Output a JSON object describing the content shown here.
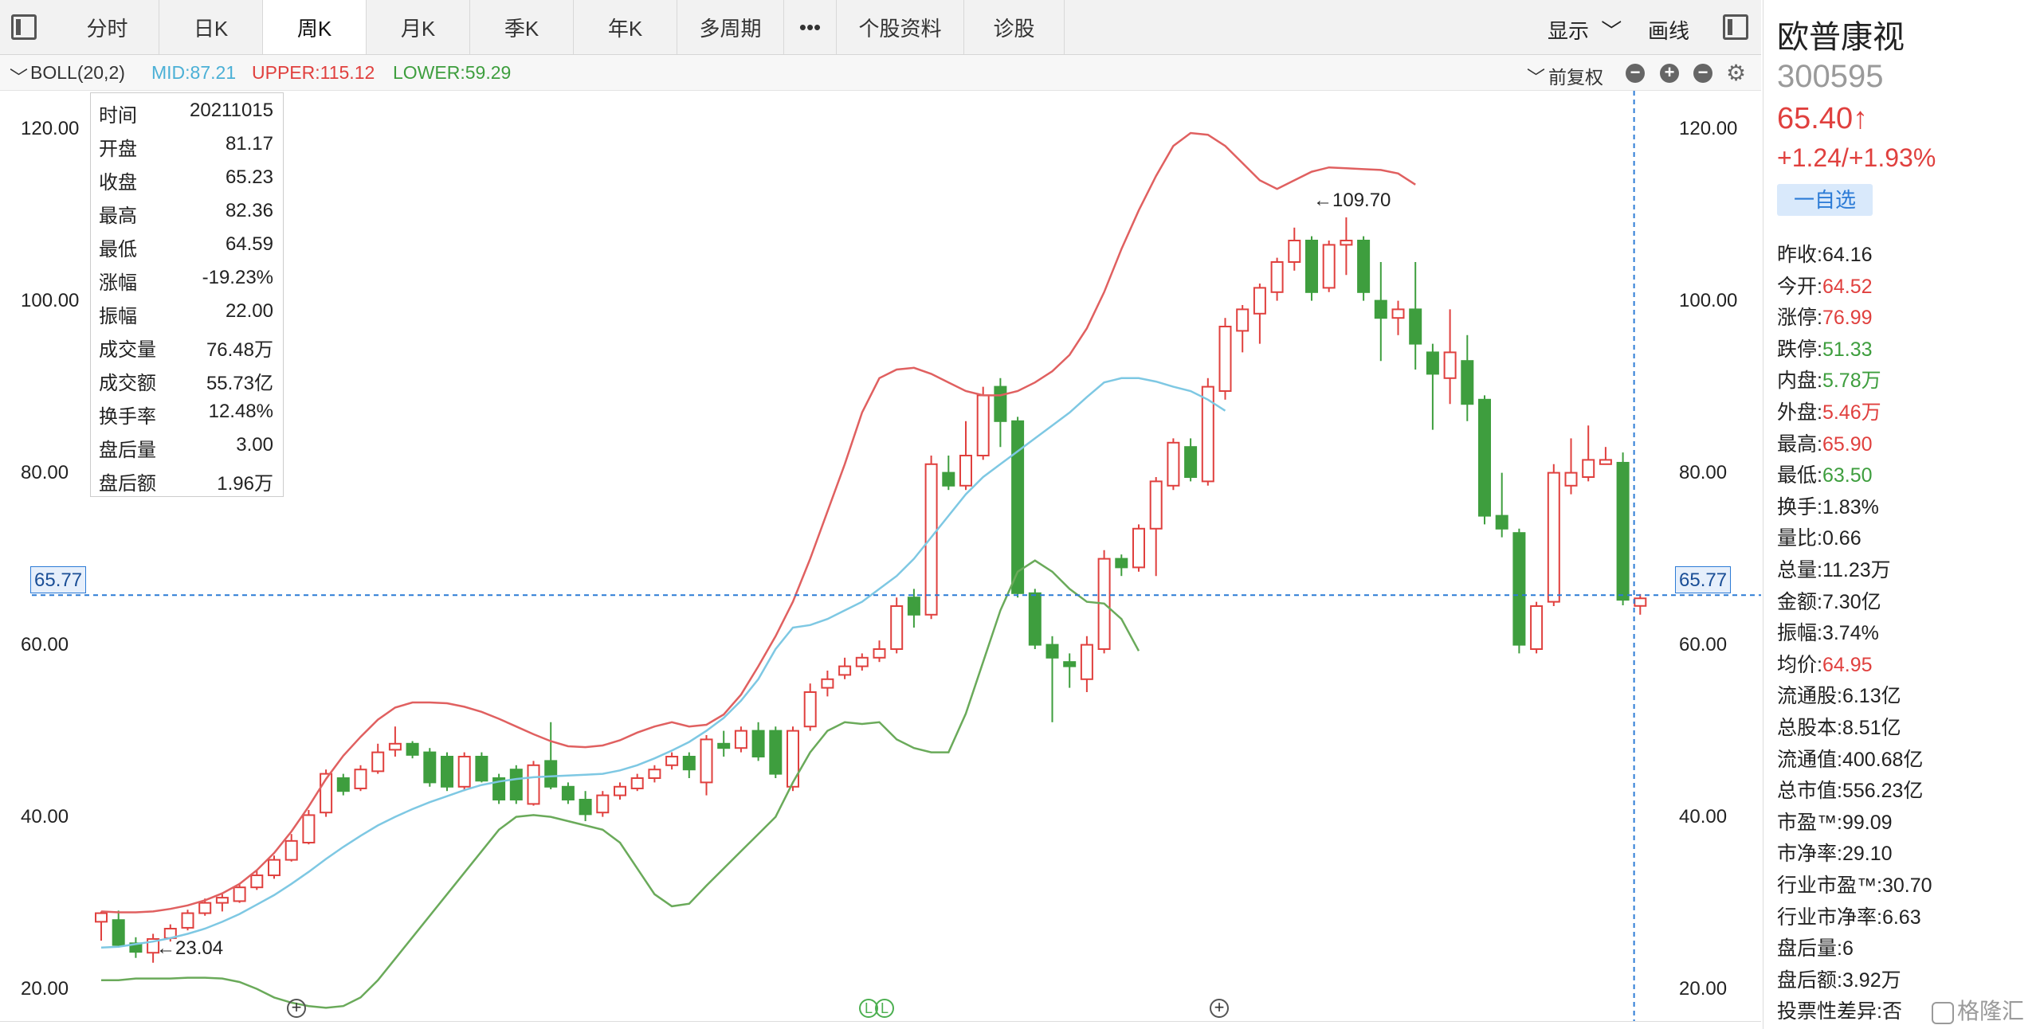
{
  "tabs": [
    {
      "label": "分时",
      "active": false
    },
    {
      "label": "日K",
      "active": false
    },
    {
      "label": "周K",
      "active": true
    },
    {
      "label": "月K",
      "active": false
    },
    {
      "label": "季K",
      "active": false
    },
    {
      "label": "年K",
      "active": false
    },
    {
      "label": "多周期",
      "active": false
    },
    {
      "label": "•••",
      "active": false
    },
    {
      "label": "个股资料",
      "active": false
    },
    {
      "label": "诊股",
      "active": false
    }
  ],
  "toolbar": {
    "display_label": "显示",
    "draw_label": "画线"
  },
  "indicator": {
    "name": "BOLL(20,2)",
    "mid": "MID:87.21",
    "upper": "UPPER:115.12",
    "lower": "LOWER:59.29",
    "adjust_label": "前复权"
  },
  "colors": {
    "up": "#e0403e",
    "down": "#3e9e3e",
    "mid": "#7ec8e3",
    "upper": "#e06060",
    "lower": "#6aaa5a",
    "crosshair": "#2c7bd6"
  },
  "info_box": [
    {
      "k": "时间",
      "v": "20211015",
      "c": "dark"
    },
    {
      "k": "开盘",
      "v": "81.17",
      "c": "red"
    },
    {
      "k": "收盘",
      "v": "65.23",
      "c": "green"
    },
    {
      "k": "最高",
      "v": "82.36",
      "c": "red"
    },
    {
      "k": "最低",
      "v": "64.59",
      "c": "green"
    },
    {
      "k": "涨幅",
      "v": "-19.23%",
      "c": "green"
    },
    {
      "k": "振幅",
      "v": "22.00",
      "c": "dark"
    },
    {
      "k": "成交量",
      "v": "76.48万",
      "c": "dark"
    },
    {
      "k": "成交额",
      "v": "55.73亿",
      "c": "dark"
    },
    {
      "k": "换手率",
      "v": "12.48%",
      "c": "dark"
    },
    {
      "k": "盘后量",
      "v": "3.00",
      "c": "dark"
    },
    {
      "k": "盘后额",
      "v": "1.96万",
      "c": "dark"
    }
  ],
  "crosshair": {
    "price_label": "65.77"
  },
  "annotations": {
    "high": "←109.70",
    "low": "←23.04"
  },
  "chart_data": {
    "type": "candlestick",
    "ylim": [
      17,
      122
    ],
    "yticks": [
      "120.00",
      "100.00",
      "80.00",
      "60.00",
      "40.00",
      "20.00"
    ],
    "crosshair_value": 65.77,
    "candles": [
      [
        27.8,
        28.8,
        25.6,
        29.0
      ],
      [
        28.0,
        25.1,
        24.8,
        29.1
      ],
      [
        25.3,
        24.3,
        23.6,
        26.0
      ],
      [
        24.2,
        25.8,
        23.04,
        26.4
      ],
      [
        25.9,
        27.0,
        25.5,
        27.5
      ],
      [
        27.1,
        28.8,
        26.8,
        29.2
      ],
      [
        28.8,
        30.0,
        28.5,
        30.5
      ],
      [
        30.0,
        30.6,
        29.0,
        31.2
      ],
      [
        30.2,
        31.8,
        30.0,
        32.3
      ],
      [
        31.8,
        33.2,
        31.5,
        33.8
      ],
      [
        33.2,
        35.0,
        32.8,
        35.5
      ],
      [
        35.0,
        37.2,
        34.8,
        38.0
      ],
      [
        37.0,
        40.2,
        36.8,
        40.8
      ],
      [
        40.5,
        45.0,
        40.0,
        45.5
      ],
      [
        44.5,
        43.0,
        42.5,
        45.0
      ],
      [
        43.3,
        45.5,
        43.0,
        46.0
      ],
      [
        45.3,
        47.5,
        45.0,
        48.5
      ],
      [
        47.8,
        48.5,
        47.0,
        50.5
      ],
      [
        48.5,
        47.2,
        46.8,
        48.8
      ],
      [
        47.5,
        44.0,
        43.5,
        48.0
      ],
      [
        47.0,
        43.5,
        43.0,
        47.5
      ],
      [
        43.5,
        47.0,
        43.0,
        47.5
      ],
      [
        47.0,
        44.2,
        44.0,
        47.5
      ],
      [
        44.5,
        42.0,
        41.5,
        45.0
      ],
      [
        45.5,
        42.0,
        41.5,
        46.0
      ],
      [
        41.5,
        46.0,
        41.3,
        46.5
      ],
      [
        46.5,
        43.5,
        43.2,
        51.0
      ],
      [
        43.5,
        42.0,
        41.5,
        44.0
      ],
      [
        42.0,
        40.3,
        39.5,
        43.0
      ],
      [
        40.5,
        42.5,
        40.0,
        43.0
      ],
      [
        42.5,
        43.5,
        42.0,
        44.0
      ],
      [
        43.3,
        44.5,
        43.0,
        45.0
      ],
      [
        44.5,
        45.5,
        44.0,
        46.0
      ],
      [
        46.0,
        47.0,
        45.5,
        47.5
      ],
      [
        47.0,
        45.5,
        44.5,
        47.5
      ],
      [
        44.0,
        49.0,
        42.5,
        49.5
      ],
      [
        48.5,
        48.0,
        47.0,
        50.0
      ],
      [
        48.0,
        50.0,
        47.5,
        50.5
      ],
      [
        50.0,
        47.0,
        46.5,
        51.0
      ],
      [
        50.0,
        45.0,
        44.5,
        50.5
      ],
      [
        43.5,
        50.0,
        43.0,
        50.5
      ],
      [
        50.5,
        54.5,
        50.0,
        55.5
      ],
      [
        55.0,
        56.0,
        54.0,
        57.0
      ],
      [
        56.5,
        57.5,
        56.0,
        58.5
      ],
      [
        57.5,
        58.5,
        57.0,
        59.0
      ],
      [
        58.5,
        59.5,
        58.0,
        60.5
      ],
      [
        59.5,
        64.5,
        59.0,
        65.5
      ],
      [
        65.5,
        63.5,
        62.0,
        66.5
      ],
      [
        63.5,
        81.0,
        63.0,
        82.0
      ],
      [
        80.0,
        78.5,
        78.0,
        82.0
      ],
      [
        78.5,
        82.0,
        78.0,
        86.0
      ],
      [
        82.0,
        89.0,
        81.5,
        90.0
      ],
      [
        90.0,
        86.0,
        83.0,
        91.0
      ],
      [
        86.0,
        66.0,
        65.5,
        86.5
      ],
      [
        66.0,
        60.0,
        59.5,
        66.5
      ],
      [
        60.0,
        58.5,
        51.0,
        61.0
      ],
      [
        58.0,
        57.5,
        55.0,
        59.0
      ],
      [
        56.0,
        60.0,
        54.5,
        61.0
      ],
      [
        59.5,
        70.0,
        59.0,
        71.0
      ],
      [
        70.0,
        69.0,
        68.0,
        70.5
      ],
      [
        69.0,
        73.5,
        68.5,
        74.0
      ],
      [
        73.5,
        79.0,
        68.0,
        79.5
      ],
      [
        78.5,
        83.5,
        78.0,
        84.0
      ],
      [
        83.0,
        79.5,
        79.0,
        84.0
      ],
      [
        79.0,
        90.0,
        78.5,
        91.0
      ],
      [
        89.5,
        97.0,
        88.5,
        98.0
      ],
      [
        96.5,
        99.0,
        94.0,
        99.5
      ],
      [
        98.5,
        101.5,
        95.0,
        102.0
      ],
      [
        101.0,
        104.5,
        100.0,
        105.0
      ],
      [
        104.5,
        107.0,
        103.5,
        108.5
      ],
      [
        107.0,
        101.0,
        100.0,
        107.5
      ],
      [
        101.5,
        106.5,
        101.0,
        107.0
      ],
      [
        106.5,
        107.0,
        103.0,
        109.7
      ],
      [
        107.0,
        101.0,
        100.0,
        107.5
      ],
      [
        100.0,
        98.0,
        93.0,
        104.5
      ],
      [
        98.0,
        99.0,
        96.0,
        100.0
      ],
      [
        99.0,
        95.0,
        92.0,
        104.5
      ],
      [
        94.0,
        91.5,
        85.0,
        95.0
      ],
      [
        91.0,
        94.0,
        88.0,
        99.0
      ],
      [
        93.0,
        88.0,
        86.0,
        96.0
      ],
      [
        88.5,
        75.0,
        74.0,
        89.0
      ],
      [
        75.0,
        73.5,
        72.5,
        80.0
      ],
      [
        73.0,
        60.0,
        59.0,
        73.5
      ],
      [
        59.5,
        64.5,
        59.0,
        65.0
      ],
      [
        65.0,
        80.0,
        64.5,
        81.0
      ],
      [
        78.5,
        80.0,
        77.5,
        84.0
      ],
      [
        79.5,
        81.5,
        79.0,
        85.5
      ],
      [
        81.0,
        81.5,
        81.0,
        83.0
      ],
      [
        81.17,
        65.23,
        64.59,
        82.36
      ],
      [
        64.52,
        65.4,
        63.5,
        65.9
      ]
    ],
    "upper": [
      29.0,
      28.9,
      28.9,
      29.0,
      29.3,
      29.7,
      30.3,
      31.1,
      32.2,
      33.8,
      35.8,
      38.3,
      41.2,
      44.4,
      47.1,
      49.3,
      51.3,
      52.7,
      53.3,
      53.3,
      53.2,
      52.8,
      52.2,
      51.4,
      50.5,
      49.6,
      48.8,
      48.2,
      48.1,
      48.3,
      48.9,
      49.8,
      50.5,
      51.0,
      50.5,
      50.7,
      51.9,
      54.2,
      57.5,
      61.0,
      65.0,
      70.0,
      75.5,
      81.0,
      87.0,
      91.0,
      92.0,
      92.2,
      91.5,
      90.5,
      89.5,
      89.0,
      89.0,
      89.5,
      90.5,
      91.8,
      93.7,
      96.8,
      101.0,
      106.0,
      110.5,
      114.5,
      118.0,
      119.5,
      119.3,
      118.0,
      116.0,
      114.0,
      113.0,
      114.0,
      115.0,
      115.5,
      115.4,
      115.3,
      115.2,
      114.8,
      113.5
    ],
    "mid": [
      24.8,
      24.9,
      25.2,
      25.5,
      25.9,
      26.4,
      27.0,
      27.8,
      28.7,
      29.8,
      30.9,
      32.2,
      33.6,
      35.1,
      36.5,
      37.8,
      39.0,
      40.0,
      40.9,
      41.7,
      42.4,
      43.1,
      43.7,
      44.1,
      44.4,
      44.6,
      44.7,
      44.8,
      44.9,
      45.0,
      45.4,
      46.0,
      46.8,
      47.7,
      48.7,
      50.0,
      51.5,
      53.5,
      56.0,
      59.5,
      62.0,
      62.3,
      63.0,
      64.0,
      65.0,
      66.5,
      68.0,
      70.0,
      72.5,
      75.0,
      77.5,
      79.5,
      81.0,
      82.5,
      84.0,
      85.5,
      87.0,
      88.8,
      90.5,
      91.0,
      91.0,
      90.6,
      90.0,
      89.5,
      88.5,
      87.21
    ],
    "lower": [
      21.0,
      21.0,
      21.2,
      21.2,
      21.2,
      21.3,
      21.3,
      21.2,
      20.8,
      20.0,
      19.0,
      18.4,
      18.0,
      17.8,
      18.0,
      19.0,
      21.0,
      23.5,
      26.0,
      28.5,
      31.0,
      33.5,
      36.0,
      38.5,
      40.0,
      40.2,
      40.0,
      39.5,
      39.0,
      38.5,
      37.0,
      34.0,
      31.0,
      29.6,
      29.9,
      32.0,
      34.0,
      36.0,
      38.0,
      40.0,
      44.0,
      47.5,
      50.0,
      51.0,
      50.8,
      51.0,
      49.0,
      48.0,
      47.5,
      47.5,
      52.0,
      58.0,
      64.0,
      68.5,
      69.8,
      68.5,
      66.5,
      65.0,
      64.8,
      63.0,
      59.29
    ]
  },
  "axis_controls": {
    "plus_label": "+",
    "ll_label": "L"
  },
  "stock": {
    "name": "欧普康视",
    "code": "300595",
    "price": "65.40↑",
    "change": "+1.24/+1.93%",
    "watch_btn": "一自选",
    "stats": [
      {
        "k": "昨收:",
        "v": "64.16",
        "c": "dark"
      },
      {
        "k": "今开:",
        "v": "64.52",
        "c": "red"
      },
      {
        "k": "涨停:",
        "v": "76.99",
        "c": "red"
      },
      {
        "k": "跌停:",
        "v": "51.33",
        "c": "green"
      },
      {
        "k": "内盘:",
        "v": "5.78万",
        "c": "green"
      },
      {
        "k": "外盘:",
        "v": "5.46万",
        "c": "red"
      },
      {
        "k": "最高:",
        "v": "65.90",
        "c": "red"
      },
      {
        "k": "最低:",
        "v": "63.50",
        "c": "green"
      },
      {
        "k": "换手:",
        "v": "1.83%",
        "c": "dark"
      },
      {
        "k": "量比:",
        "v": "0.66",
        "c": "dark"
      },
      {
        "k": "总量:",
        "v": "11.23万",
        "c": "dark"
      },
      {
        "k": "金额:",
        "v": "7.30亿",
        "c": "dark"
      },
      {
        "k": "振幅:",
        "v": "3.74%",
        "c": "dark"
      },
      {
        "k": "均价:",
        "v": "64.95",
        "c": "red"
      },
      {
        "k": "流通股:",
        "v": "6.13亿",
        "c": "dark"
      },
      {
        "k": "总股本:",
        "v": "8.51亿",
        "c": "dark"
      },
      {
        "k": "流通值:",
        "v": "400.68亿",
        "c": "dark"
      },
      {
        "k": "总市值:",
        "v": "556.23亿",
        "c": "dark"
      },
      {
        "k": "市盈™:",
        "v": "99.09",
        "c": "dark"
      },
      {
        "k": "市净率:",
        "v": "29.10",
        "c": "dark"
      },
      {
        "k": "行业市盈™:",
        "v": "30.70",
        "c": "dark"
      },
      {
        "k": "行业市净率:",
        "v": "6.63",
        "c": "dark"
      },
      {
        "k": "盘后量:",
        "v": "6",
        "c": "dark"
      },
      {
        "k": "盘后额:",
        "v": "3.92万",
        "c": "dark"
      },
      {
        "k": "投票性差异:",
        "v": "否",
        "c": "dark"
      }
    ],
    "watermark": "格隆汇"
  }
}
